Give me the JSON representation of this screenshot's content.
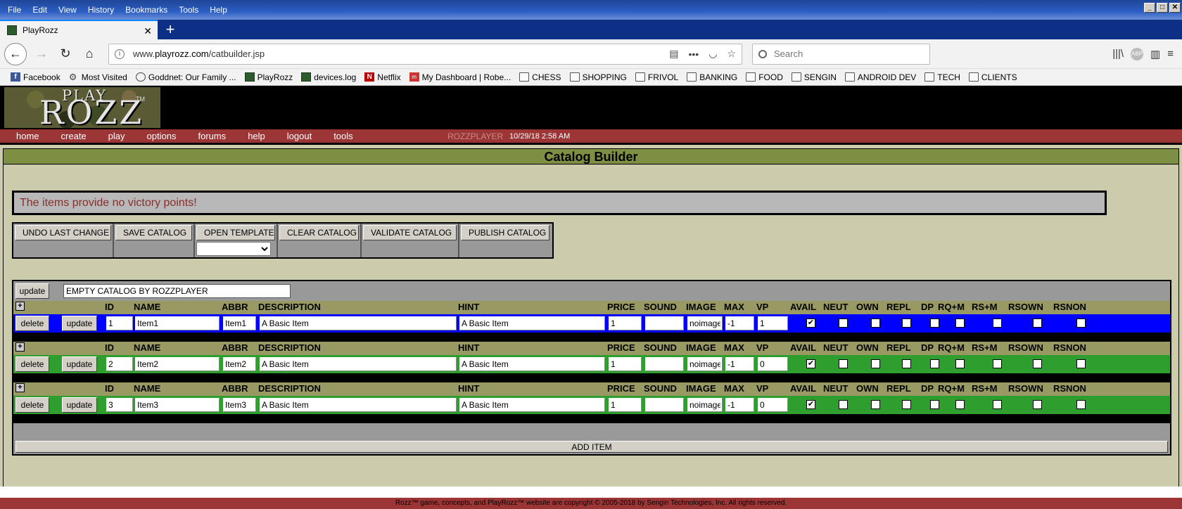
{
  "menubar": [
    "File",
    "Edit",
    "View",
    "History",
    "Bookmarks",
    "Tools",
    "Help"
  ],
  "tab": {
    "title": "PlayRozz"
  },
  "url": {
    "prefix": "www.",
    "host": "playrozz.com",
    "path": "/catbuilder.jsp"
  },
  "search": {
    "placeholder": "Search"
  },
  "bookmarks": [
    {
      "label": "Facebook",
      "icon": "facebook-icon"
    },
    {
      "label": "Most Visited",
      "icon": "gear-icon"
    },
    {
      "label": "Goddnet: Our Family ...",
      "icon": "globe-icon"
    },
    {
      "label": "PlayRozz",
      "icon": "playrozz-icon"
    },
    {
      "label": "devices.log",
      "icon": "playrozz-icon"
    },
    {
      "label": "Netflix",
      "icon": "netflix-icon"
    },
    {
      "label": "My Dashboard | Robe...",
      "icon": "dashboard-icon"
    },
    {
      "label": "CHESS",
      "icon": "folder-icon"
    },
    {
      "label": "SHOPPING",
      "icon": "folder-icon"
    },
    {
      "label": "FRIVOL",
      "icon": "folder-icon"
    },
    {
      "label": "BANKING",
      "icon": "folder-icon"
    },
    {
      "label": "FOOD",
      "icon": "folder-icon"
    },
    {
      "label": "SENGIN",
      "icon": "folder-icon"
    },
    {
      "label": "ANDROID DEV",
      "icon": "folder-icon"
    },
    {
      "label": "TECH",
      "icon": "folder-icon"
    },
    {
      "label": "CLIENTS",
      "icon": "folder-icon"
    }
  ],
  "logo": {
    "play": "PLAY",
    "rozz": "ROZZ",
    "tm": "TM"
  },
  "site_nav": {
    "links": [
      "home",
      "create",
      "play",
      "options",
      "forums",
      "help",
      "logout",
      "tools"
    ],
    "username": "ROZZPLAYER",
    "timestamp": "10/29/18 2:58 AM"
  },
  "page_title": "Catalog Builder",
  "warning": "The items provide no victory points!",
  "actions": [
    "UNDO LAST CHANGE",
    "SAVE CATALOG",
    "OPEN TEMPLATE",
    "CLEAR CATALOG",
    "VALIDATE CATALOG",
    "PUBLISH CATALOG"
  ],
  "catalog": {
    "update_label": "update",
    "name": "EMPTY CATALOG BY ROZZPLAYER"
  },
  "columns": [
    "ID",
    "NAME",
    "ABBR",
    "DESCRIPTION",
    "HINT",
    "PRICE",
    "SOUND",
    "IMAGE",
    "MAX",
    "VP",
    "AVAIL",
    "NEUT",
    "OWN",
    "REPL",
    "DP",
    "RQ+M",
    "RS+M",
    "RSOWN",
    "RSNON"
  ],
  "row_buttons": {
    "delete": "delete",
    "update": "update"
  },
  "items": [
    {
      "id": "1",
      "name": "Item1",
      "abbr": "Item1",
      "description": "A Basic Item",
      "hint": "A Basic Item",
      "price": "1",
      "sound": "",
      "image": "noimage",
      "max": "-1",
      "vp": "1",
      "flags": [
        true,
        false,
        false,
        false,
        false,
        false,
        false,
        false,
        false
      ],
      "selected": true
    },
    {
      "id": "2",
      "name": "Item2",
      "abbr": "Item2",
      "description": "A Basic Item",
      "hint": "A Basic Item",
      "price": "1",
      "sound": "",
      "image": "noimage",
      "max": "-1",
      "vp": "0",
      "flags": [
        true,
        false,
        false,
        false,
        false,
        false,
        false,
        false,
        false
      ],
      "selected": false
    },
    {
      "id": "3",
      "name": "Item3",
      "abbr": "Item3",
      "description": "A Basic Item",
      "hint": "A Basic Item",
      "price": "1",
      "sound": "",
      "image": "noimage",
      "max": "-1",
      "vp": "0",
      "flags": [
        true,
        false,
        false,
        false,
        false,
        false,
        false,
        false,
        false
      ],
      "selected": false
    }
  ],
  "add_item": "ADD ITEM",
  "footer": "Rozz™ game, concepts, and PlayRozz™ website are copyright © 2005-2018 by Sengin Technologies, Inc. All rights reserved.",
  "colors": {
    "nav_red": "#9c3535",
    "title_olive": "#7e8f44",
    "row_selected": "#0000ff",
    "row_normal": "#2e9e2e",
    "page_bg": "#ccccac"
  }
}
